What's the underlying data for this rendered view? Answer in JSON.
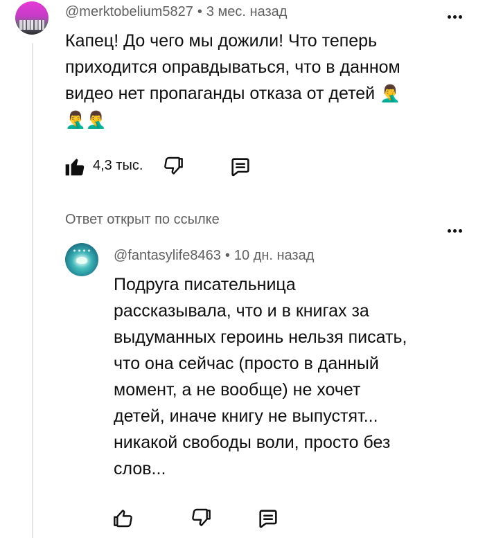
{
  "comment": {
    "author": "@merktobelium5827",
    "separator": "•",
    "time": "3 мес. назад",
    "text_lines": [
      "Капец! До чего мы дожили! Что теперь",
      "приходится оправдываться, что в данном",
      "видео нет пропаганды отказа от детей",
      ""
    ],
    "emoji": "🤦‍♂️",
    "likes": "4,3 тыс.",
    "liked": true
  },
  "reply_section": {
    "label": "Ответ открыт по ссылке"
  },
  "reply": {
    "author": "@fantasylife8463",
    "separator": "•",
    "time": "10 дн. назад",
    "text_lines": [
      "Подруга писательница",
      "рассказывала, что и в книгах за",
      "выдуманных героинь нельзя писать,",
      "что она сейчас (просто в данный",
      "момент, а не вообще) не хочет",
      "детей, иначе книгу не выпустят...",
      "никакой свободы воли, просто без",
      "слов..."
    ],
    "likes": "",
    "liked": false
  },
  "icons": {
    "like": "thumbs-up-icon",
    "dislike": "thumbs-down-icon",
    "reply": "reply-comment-icon",
    "menu": "more-vertical-icon"
  },
  "colors": {
    "text": "#0f0f0f",
    "meta": "#606060",
    "thread_line": "#e5e5e5"
  }
}
